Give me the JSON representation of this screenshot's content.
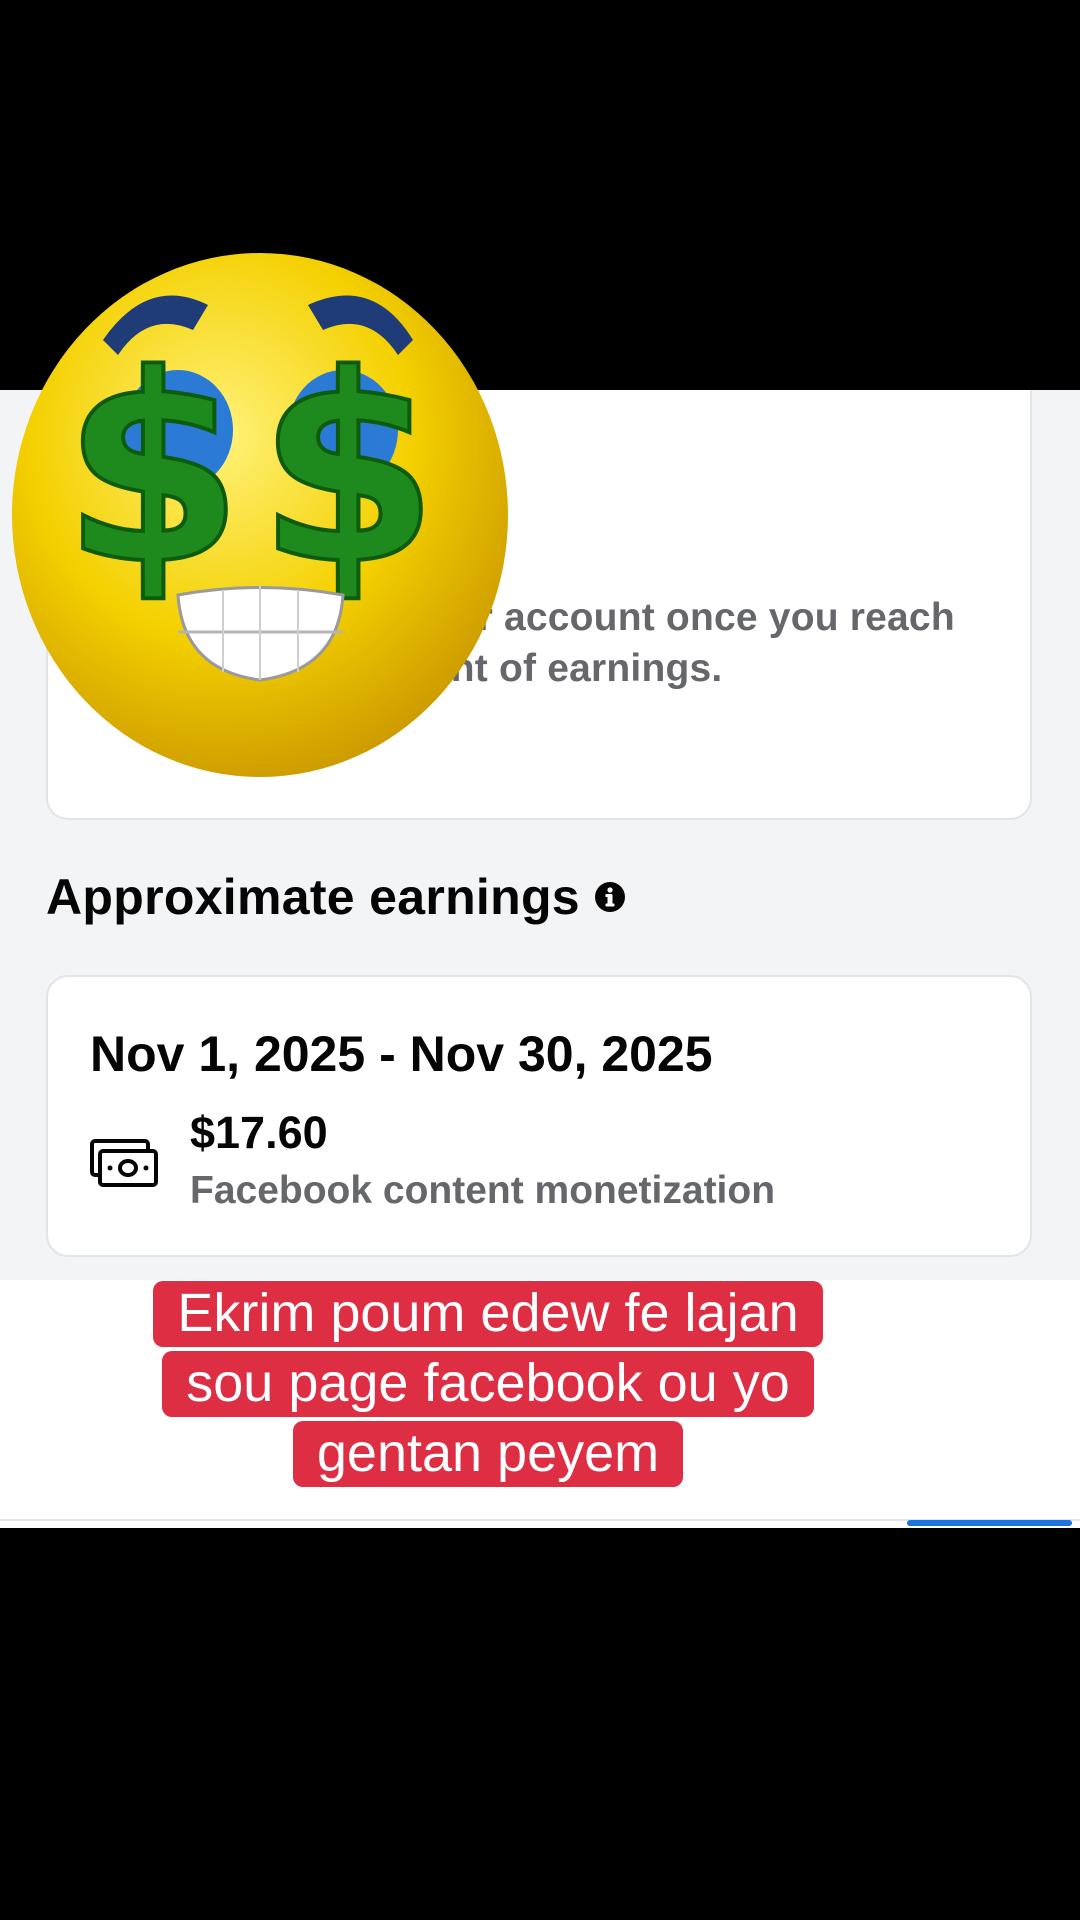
{
  "top_card": {
    "text": "… transferred to your account once you reach the minimum amount of earnings."
  },
  "section": {
    "title": "Approximate earnings"
  },
  "earnings_card": {
    "date_range": "Nov 1, 2025 - Nov 30, 2025",
    "amount": "$17.60",
    "source": "Facebook content monetization"
  },
  "caption": {
    "line1": "Ekrim poum edew fe lajan",
    "line2": "sou page facebook ou yo",
    "line3": "gentan peyem"
  },
  "icons": {
    "info": "info-icon",
    "money": "money-bill-icon",
    "emoji": "money-eyes-emoji"
  },
  "colors": {
    "accent": "#1b74e4",
    "caption_bg": "#dd2e44"
  }
}
